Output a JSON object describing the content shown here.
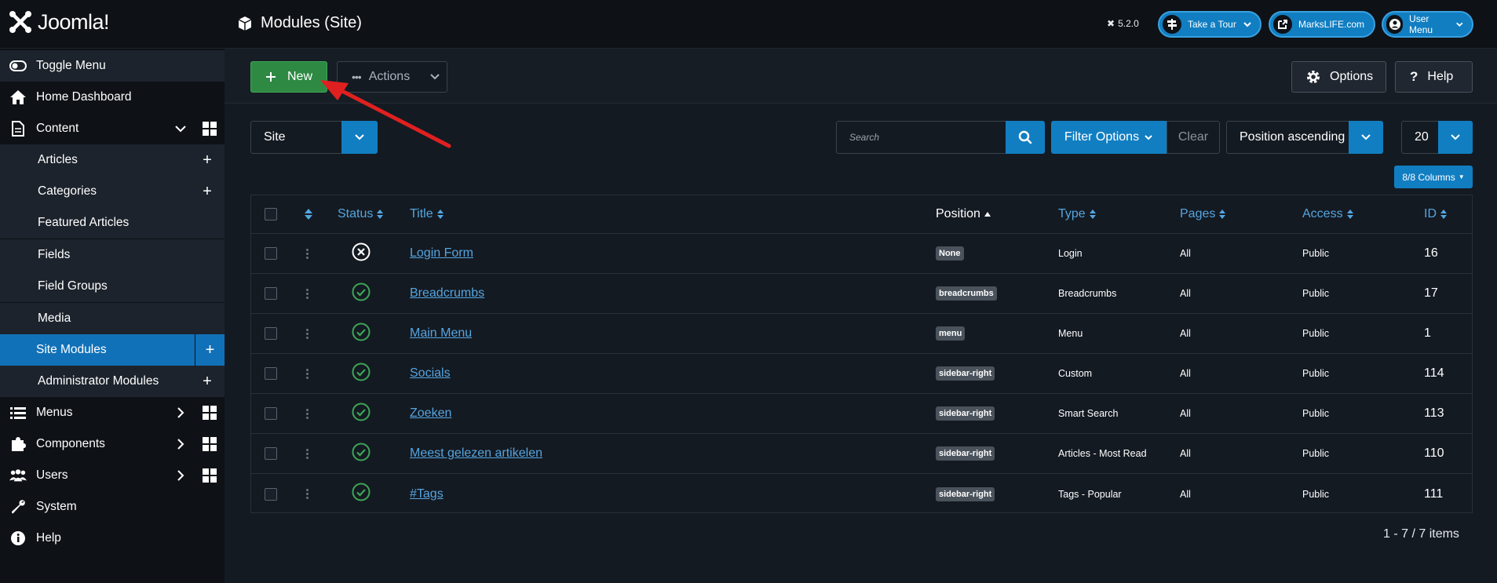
{
  "header": {
    "logo_text": "Joomla!",
    "page_title": "Modules (Site)",
    "version": "5.2.0",
    "take_tour": "Take a Tour",
    "site_link": "MarksLIFE.com",
    "user_menu": "User Menu"
  },
  "sidebar": {
    "items": [
      {
        "label": "Toggle Menu",
        "icon": "toggle-icon"
      },
      {
        "label": "Home Dashboard",
        "icon": "home-icon"
      },
      {
        "label": "Content",
        "icon": "file-icon"
      },
      {
        "label": "Articles"
      },
      {
        "label": "Categories"
      },
      {
        "label": "Featured Articles"
      },
      {
        "label": "Fields"
      },
      {
        "label": "Field Groups"
      },
      {
        "label": "Media"
      },
      {
        "label": "Site Modules"
      },
      {
        "label": "Administrator Modules"
      },
      {
        "label": "Menus",
        "icon": "list-icon"
      },
      {
        "label": "Components",
        "icon": "puzzle-icon"
      },
      {
        "label": "Users",
        "icon": "users-icon"
      },
      {
        "label": "System",
        "icon": "wrench-icon"
      },
      {
        "label": "Help",
        "icon": "info-icon"
      }
    ]
  },
  "toolbar": {
    "new_label": "New",
    "actions_label": "Actions",
    "options_label": "Options",
    "help_label": "Help"
  },
  "filters": {
    "client_select": "Site",
    "search_placeholder": "Search",
    "filter_options": "Filter Options",
    "clear": "Clear",
    "ordering": "Position ascending",
    "limit": "20",
    "columns": "8/8 Columns"
  },
  "table": {
    "headers": {
      "status": "Status",
      "title": "Title",
      "position": "Position",
      "type": "Type",
      "pages": "Pages",
      "access": "Access",
      "id": "ID"
    },
    "rows": [
      {
        "status": "unpublished",
        "title": "Login Form",
        "position": "None",
        "type": "Login",
        "pages": "All",
        "access": "Public",
        "id": "16"
      },
      {
        "status": "published",
        "title": "Breadcrumbs",
        "position": "breadcrumbs",
        "type": "Breadcrumbs",
        "pages": "All",
        "access": "Public",
        "id": "17"
      },
      {
        "status": "published",
        "title": "Main Menu",
        "position": "menu",
        "type": "Menu",
        "pages": "All",
        "access": "Public",
        "id": "1"
      },
      {
        "status": "published",
        "title": "Socials",
        "position": "sidebar-right",
        "type": "Custom",
        "pages": "All",
        "access": "Public",
        "id": "114"
      },
      {
        "status": "published",
        "title": "Zoeken",
        "position": "sidebar-right",
        "type": "Smart Search",
        "pages": "All",
        "access": "Public",
        "id": "113"
      },
      {
        "status": "published",
        "title": "Meest gelezen artikelen",
        "position": "sidebar-right",
        "type": "Articles - Most Read",
        "pages": "All",
        "access": "Public",
        "id": "110"
      },
      {
        "status": "published",
        "title": "#Tags",
        "position": "sidebar-right",
        "type": "Tags - Popular",
        "pages": "All",
        "access": "Public",
        "id": "111"
      }
    ]
  },
  "pagination": "1 - 7 / 7 items",
  "colors": {
    "accent": "#117ec2",
    "success": "#2e8a43",
    "link": "#55a5e0",
    "annotation_arrow": "#e02020"
  }
}
